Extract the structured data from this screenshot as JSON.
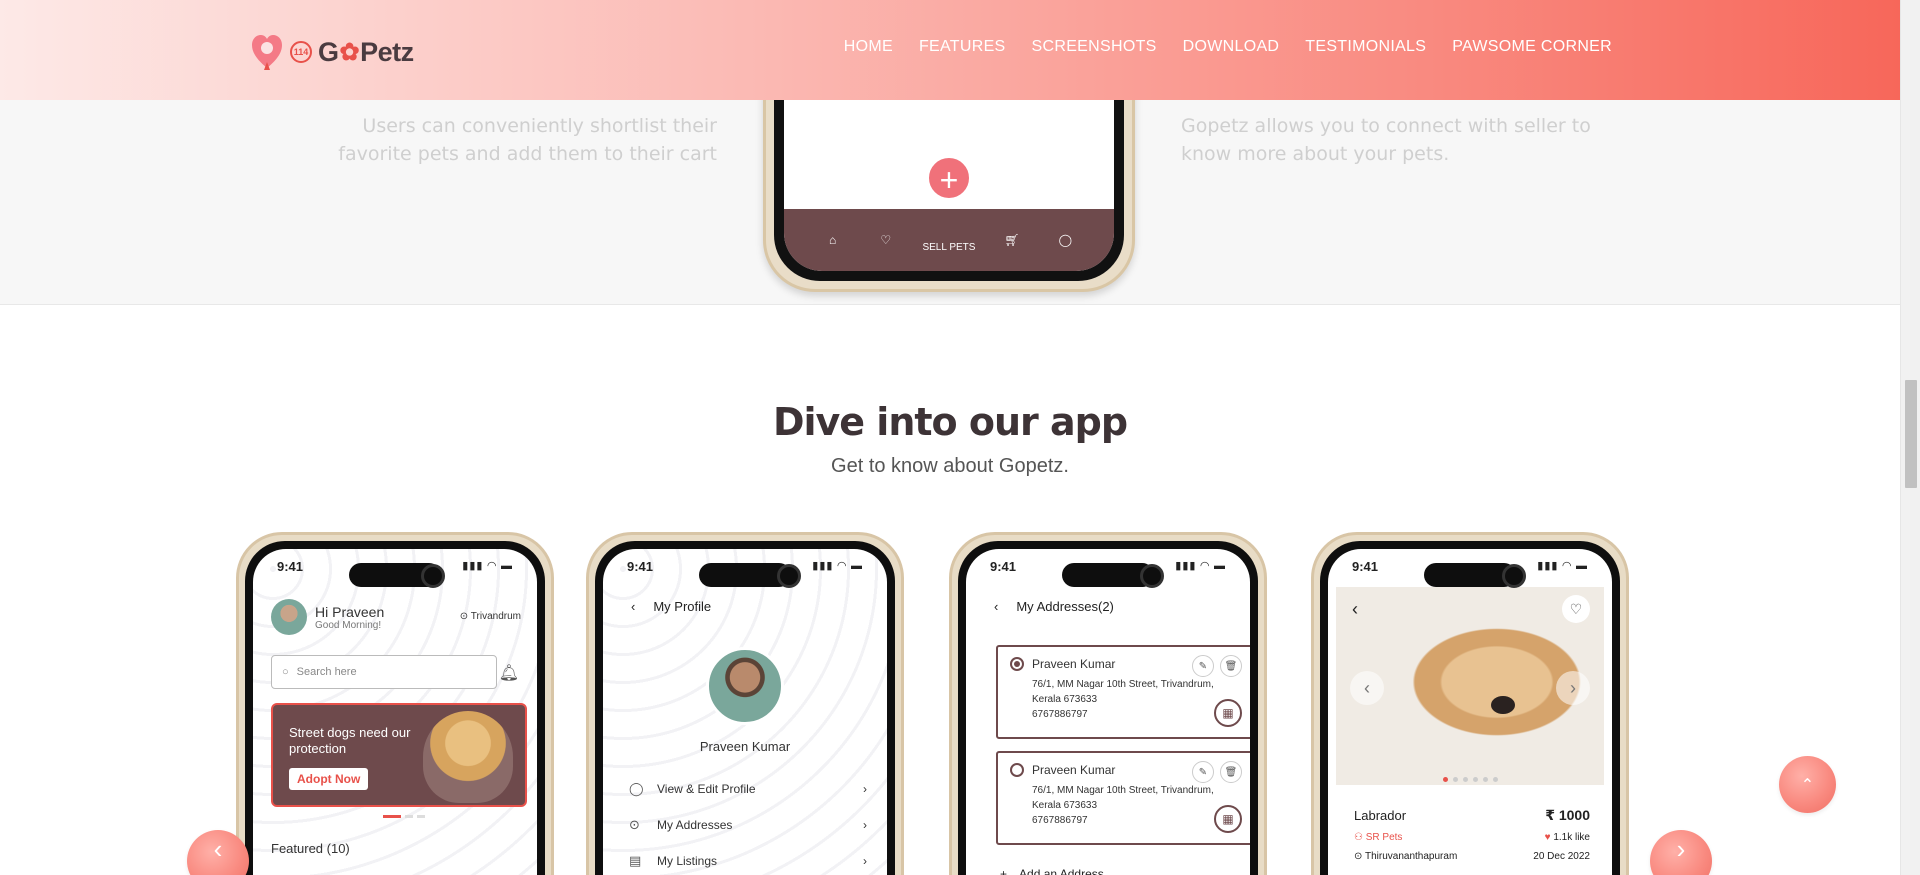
{
  "header": {
    "logo": {
      "badge": "114",
      "brand_prefix": "G",
      "brand_suffix": "Petz"
    },
    "nav": [
      "HOME",
      "FEATURES",
      "SCREENSHOTS",
      "DOWNLOAD",
      "TESTIMONIALS",
      "PAWSOME CORNER"
    ]
  },
  "features": {
    "left_text": "Users can conveniently shortlist their favorite pets and add them to their cart",
    "right_text": "Gopetz allows you to connect with seller to know more about your pets.",
    "phone_tab_label": "SELL PETS"
  },
  "dive": {
    "title": "Dive into our app",
    "subtitle": "Get to know about Gopetz."
  },
  "phones": {
    "time": "9:41",
    "home": {
      "greeting": "Hi Praveen",
      "subgreeting": "Good Morning!",
      "location": "Trivandrum",
      "search_placeholder": "Search here",
      "banner_text": "Street dogs need our protection",
      "banner_button": "Adopt Now",
      "featured": "Featured (10)"
    },
    "profile": {
      "title": "My Profile",
      "name": "Praveen Kumar",
      "menu": [
        "View & Edit Profile",
        "My Addresses",
        "My Listings"
      ]
    },
    "addresses": {
      "title": "My Addresses(2)",
      "items": [
        {
          "name": "Praveen Kumar",
          "line1": "76/1, MM Nagar 10th Street, Trivandrum,",
          "line2": "Kerala 673633",
          "phone": "6767886797"
        },
        {
          "name": "Praveen Kumar",
          "line1": "76/1, MM Nagar 10th Street, Trivandrum,",
          "line2": "Kerala 673633",
          "phone": "6767886797"
        }
      ],
      "add_label": "Add an Address"
    },
    "detail": {
      "breed": "Labrador",
      "price": "₹ 1000",
      "seller": "SR Pets",
      "likes": "1.1k like",
      "place": "Thiruvananthapuram",
      "date": "20 Dec 2022"
    }
  },
  "colors": {
    "accent": "#f98a80",
    "brand_dark": "#6e4a4c",
    "brand_red": "#e8514a"
  }
}
